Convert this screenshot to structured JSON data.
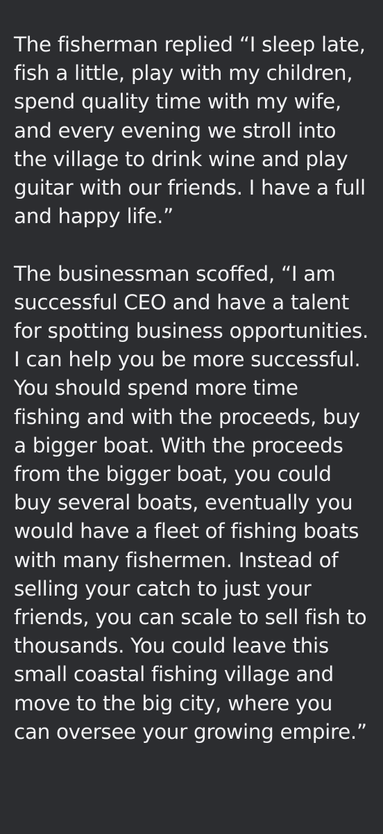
{
  "document": {
    "paragraphs": [
      "The fisherman replied “I sleep late, fish a little, play with my children, spend quality time with my wife, and every evening we stroll into the village to drink wine and play guitar with our friends. I have a full and happy life.”",
      "The businessman scoffed, “I am successful CEO and have a talent for spotting business opportunities. I can help you be more successful. You should spend more time fishing and with the proceeds, buy a bigger boat. With the proceeds from the bigger boat, you could buy several boats, eventually you would have a fleet of fishing boats with many fishermen. Instead of selling your catch to just your friends, you can scale to sell fish to thousands. You could leave this small coastal fishing village and move to the big city, where you can oversee your growing empire.”"
    ]
  },
  "colors": {
    "background": "#2c2d30",
    "text": "#f2f2f4"
  }
}
